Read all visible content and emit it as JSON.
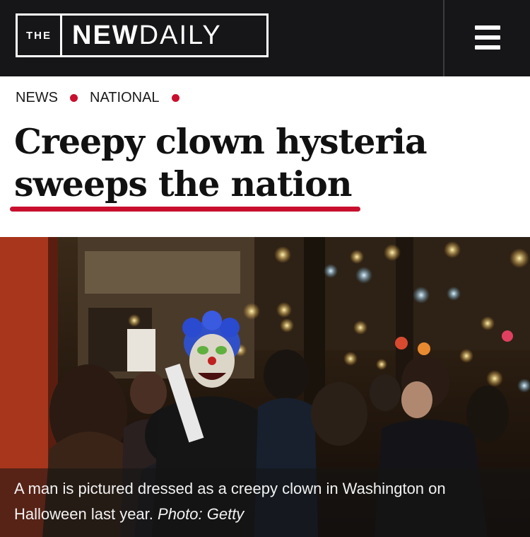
{
  "header": {
    "logo_prefix": "THE",
    "logo_name_bold": "NEW",
    "logo_name_light": "DAILY"
  },
  "breadcrumb": {
    "items": [
      "NEWS",
      "NATIONAL"
    ]
  },
  "article": {
    "headline_line1": "Creepy clown hysteria",
    "headline_line2": "sweeps the nation",
    "caption": "A man is pictured dressed as a creepy clown in Washington on Halloween last year.",
    "photo_credit": "Photo: Getty"
  },
  "icons": {
    "menu": "hamburger-menu-icon"
  },
  "colors": {
    "header_bg": "#161619",
    "accent_red": "#c8102e",
    "headline": "#111111"
  }
}
